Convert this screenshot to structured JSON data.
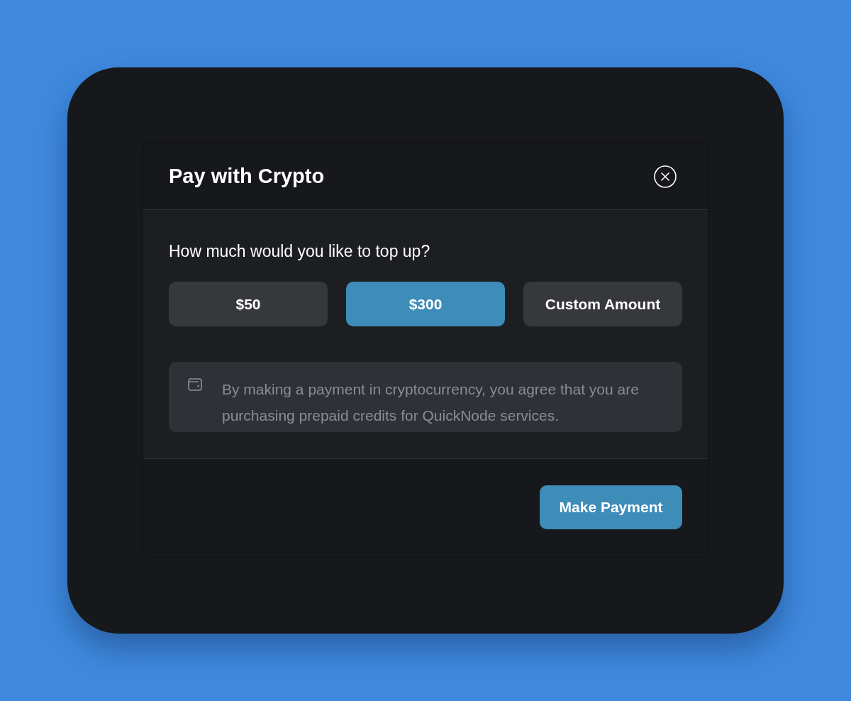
{
  "dialog": {
    "title": "Pay with Crypto",
    "question": "How much would you like to top up?",
    "amount_options": [
      {
        "label": "$50",
        "selected": false
      },
      {
        "label": "$300",
        "selected": true
      },
      {
        "label": "Custom Amount",
        "selected": false
      }
    ],
    "notice": "By making a payment in cryptocurrency, you agree that you are purchasing prepaid credits for QuickNode services.",
    "primary_button": "Make Payment"
  }
}
